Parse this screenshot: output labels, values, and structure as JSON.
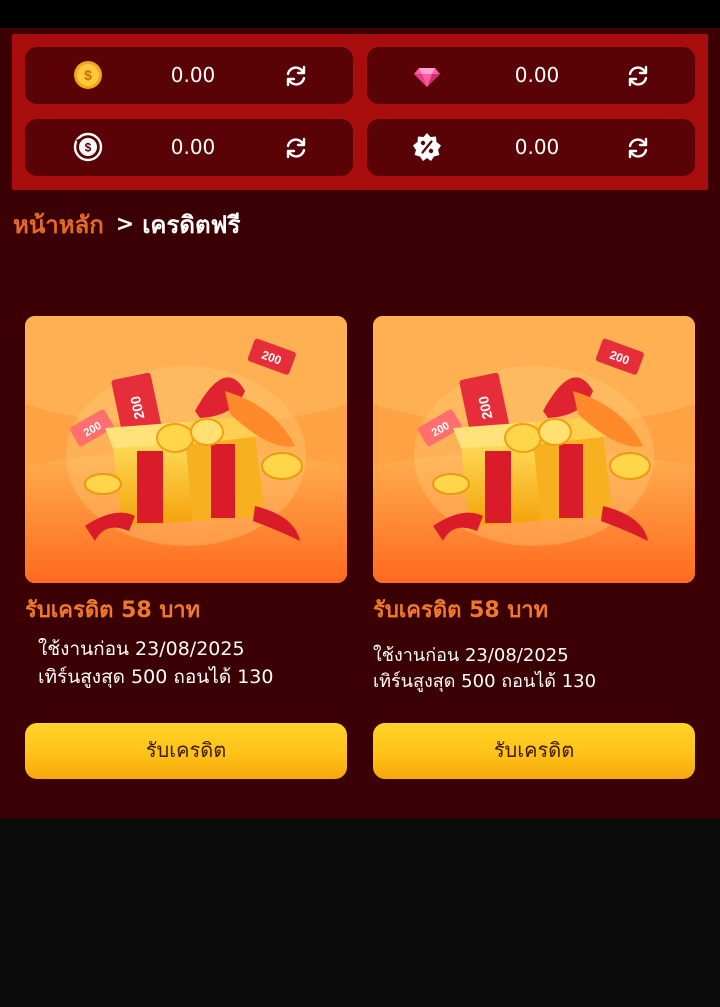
{
  "wallets": [
    {
      "icon": "gold-coin-icon",
      "value": "0.00"
    },
    {
      "icon": "pink-gem-icon",
      "value": "0.00"
    },
    {
      "icon": "dollar-cycle-icon",
      "value": "0.00"
    },
    {
      "icon": "discount-badge-icon",
      "value": "0.00"
    }
  ],
  "breadcrumb": {
    "home": "หน้าหลัก",
    "separator": ">",
    "current": "เครดิตฟรี"
  },
  "promos": [
    {
      "title": "รับเครดิต 58 บาท",
      "line1": "ใช้งานก่อน 23/08/2025",
      "line2": "เทิร์นสูงสุด 500 ถอนได้ 130",
      "button": "รับเครดิต",
      "image_icon": "gift-box-icon"
    },
    {
      "title": "รับเครดิต 58 บาท",
      "line1": "ใช้งานก่อน 23/08/2025",
      "line2": "เทิร์นสูงสุด 500 ถอนได้ 130",
      "button": "รับเครดิต",
      "image_icon": "gift-box-icon"
    }
  ],
  "colors": {
    "background": "#3a0003",
    "panel": "#a80d0d",
    "card": "#5a0306",
    "accent_orange": "#e46b25",
    "button_yellow": "#ffc218"
  }
}
